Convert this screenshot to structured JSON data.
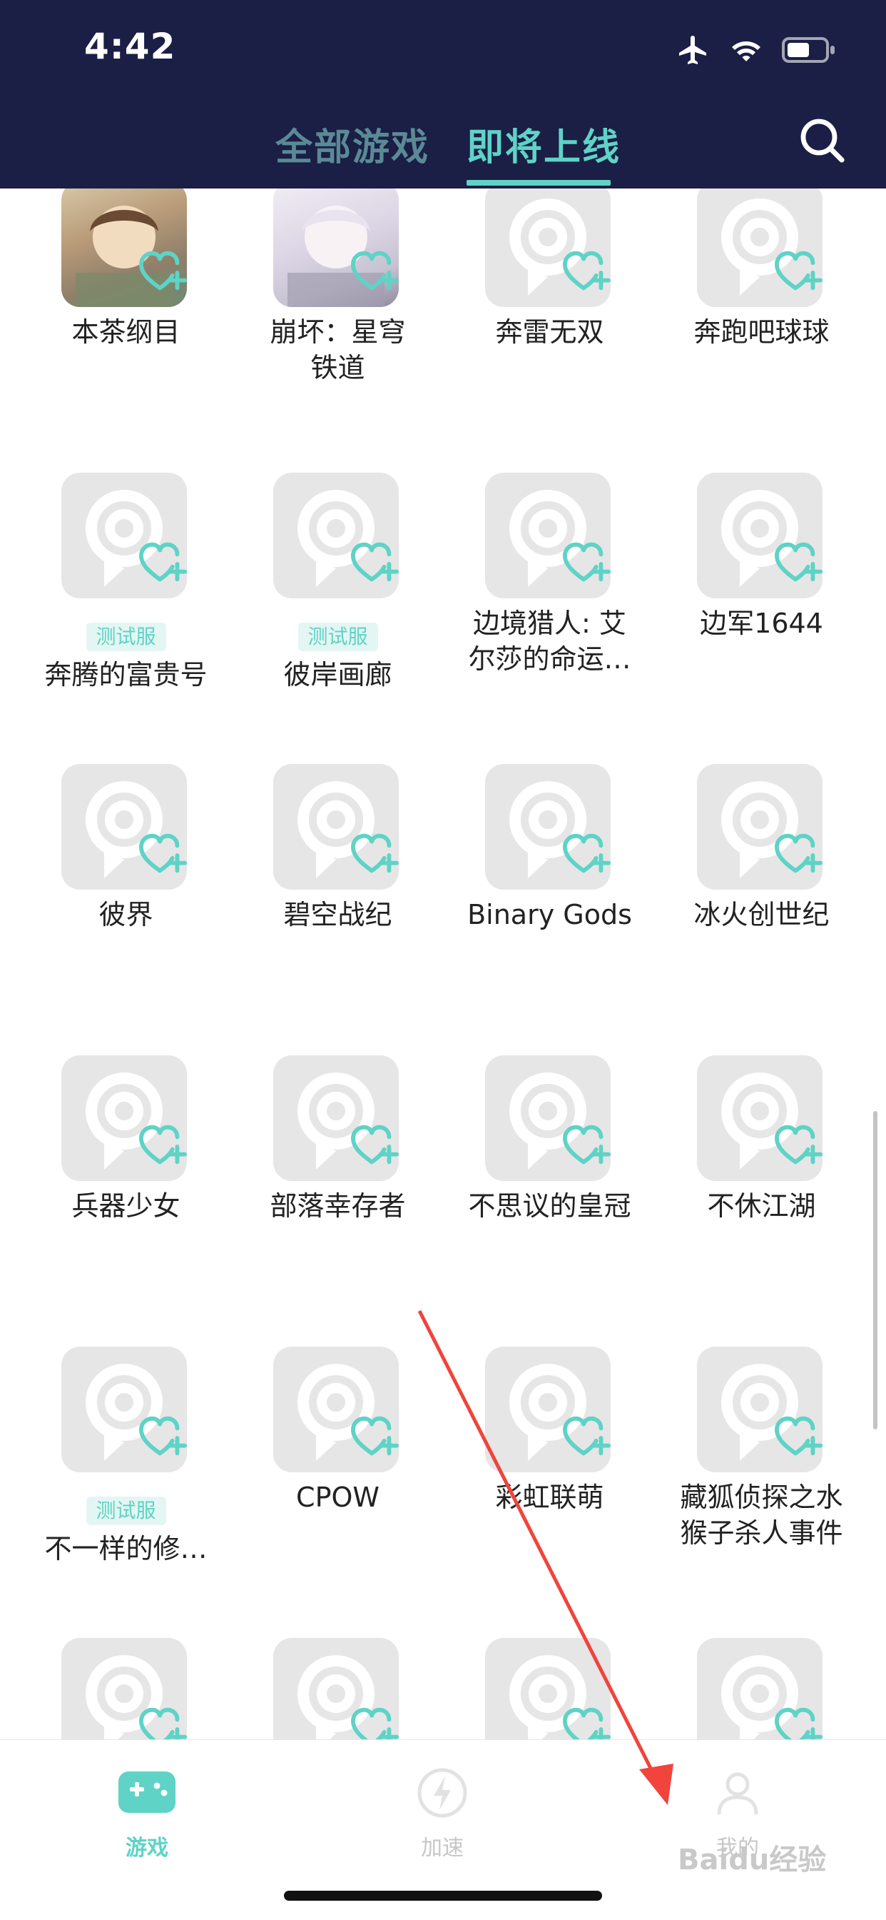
{
  "status_bar": {
    "time": "4:42"
  },
  "header": {
    "tabs": [
      {
        "label": "全部游戏",
        "active": false
      },
      {
        "label": "即将上线",
        "active": true
      }
    ]
  },
  "colors": {
    "accent": "#5ed3c6",
    "header_bg": "#1b1e45",
    "inactive_tab": "#5a8a96",
    "placeholder": "#e6e6e6"
  },
  "games": [
    {
      "name": "本茶纲目",
      "badge": "",
      "icon": "custom-art"
    },
    {
      "name": "崩坏：星穹\n铁道",
      "badge": "",
      "icon": "custom-art"
    },
    {
      "name": "奔雷无双",
      "badge": "",
      "icon": "placeholder"
    },
    {
      "name": "奔跑吧球球",
      "badge": "",
      "icon": "placeholder"
    },
    {
      "name": "奔腾的富贵号",
      "badge": "测试服",
      "icon": "placeholder"
    },
    {
      "name": "彼岸画廊",
      "badge": "测试服",
      "icon": "placeholder"
    },
    {
      "name": "边境猎人: 艾\n尔莎的命运…",
      "badge": "",
      "icon": "placeholder"
    },
    {
      "name": "边军1644",
      "badge": "",
      "icon": "placeholder"
    },
    {
      "name": "彼界",
      "badge": "",
      "icon": "placeholder"
    },
    {
      "name": "碧空战纪",
      "badge": "",
      "icon": "placeholder"
    },
    {
      "name": "Binary Gods",
      "badge": "",
      "icon": "placeholder"
    },
    {
      "name": "冰火创世纪",
      "badge": "",
      "icon": "placeholder"
    },
    {
      "name": "兵器少女",
      "badge": "",
      "icon": "placeholder"
    },
    {
      "name": "部落幸存者",
      "badge": "",
      "icon": "placeholder"
    },
    {
      "name": "不思议的皇冠",
      "badge": "",
      "icon": "placeholder"
    },
    {
      "name": "不休江湖",
      "badge": "",
      "icon": "placeholder"
    },
    {
      "name": "不一样的修…",
      "badge": "测试服",
      "icon": "placeholder"
    },
    {
      "name": "CPOW",
      "badge": "",
      "icon": "placeholder"
    },
    {
      "name": "彩虹联萌",
      "badge": "",
      "icon": "placeholder"
    },
    {
      "name": "藏狐侦探之水\n猴子杀人事件",
      "badge": "",
      "icon": "placeholder"
    },
    {
      "name": "",
      "badge": "",
      "icon": "placeholder"
    },
    {
      "name": "",
      "badge": "",
      "icon": "placeholder"
    },
    {
      "name": "",
      "badge": "",
      "icon": "placeholder"
    },
    {
      "name": "",
      "badge": "",
      "icon": "placeholder"
    }
  ],
  "bottom_nav": {
    "items": [
      {
        "label": "游戏",
        "icon": "gamepad-icon",
        "active": true
      },
      {
        "label": "加速",
        "icon": "lightning-icon",
        "active": false
      },
      {
        "label": "我的",
        "icon": "user-icon",
        "active": false
      }
    ]
  },
  "watermark": "Baidu经验"
}
